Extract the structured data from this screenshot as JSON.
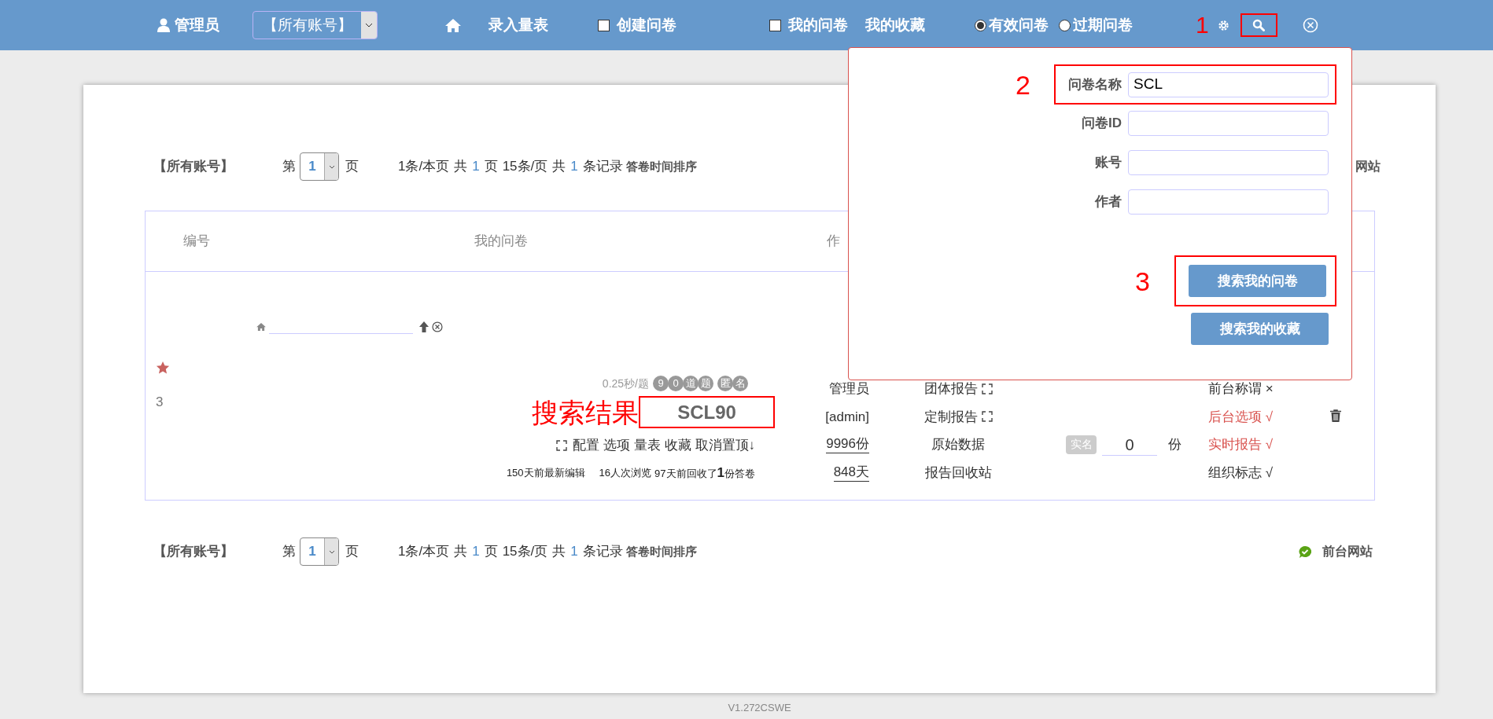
{
  "top_bar": {
    "user": "管理员",
    "account_select": "【所有账号】",
    "entry_link": "录入量表",
    "create": {
      "label": "创建问卷",
      "checked": false
    },
    "mine": {
      "label": "我的问卷",
      "checked": false
    },
    "favorites_link": "我的收藏",
    "status": [
      {
        "label": "有效问卷",
        "selected": true
      },
      {
        "label": "过期问卷",
        "selected": false
      }
    ],
    "search_marker": "1"
  },
  "search_panel": {
    "fields": [
      {
        "label": "问卷名称",
        "value": "SCL",
        "marker": "2"
      },
      {
        "label": "问卷ID"
      },
      {
        "label": "账号"
      },
      {
        "label": "作者"
      }
    ],
    "buttons": [
      {
        "label": "搜索我的问卷",
        "marker": "3"
      },
      {
        "label": "搜索我的收藏"
      }
    ]
  },
  "pagers": [
    {
      "account": "【所有账号】",
      "page_label": "第",
      "page": "1",
      "page_unit": "页",
      "summary": [
        {
          "kind": "text",
          "text": "1条/本页"
        },
        {
          "kind": "text",
          "text": "共"
        },
        {
          "kind": "count",
          "text": "1"
        },
        {
          "kind": "text",
          "text": "页"
        },
        {
          "kind": "text",
          "text": "15条/页"
        },
        {
          "kind": "text",
          "text": "共"
        },
        {
          "kind": "count",
          "text": "1"
        },
        {
          "kind": "text",
          "text": "条记录"
        }
      ],
      "sort_link": "答卷时间排序",
      "site_link": {
        "text": "网站",
        "icon": false
      }
    },
    {
      "account": "【所有账号】",
      "page_label": "第",
      "page": "1",
      "page_unit": "页",
      "summary": [
        {
          "kind": "text",
          "text": "1条/本页"
        },
        {
          "kind": "text",
          "text": "共"
        },
        {
          "kind": "count",
          "text": "1"
        },
        {
          "kind": "text",
          "text": "页"
        },
        {
          "kind": "text",
          "text": "15条/页"
        },
        {
          "kind": "text",
          "text": "共"
        },
        {
          "kind": "count",
          "text": "1"
        },
        {
          "kind": "text",
          "text": "条记录"
        }
      ],
      "sort_link": "答卷时间排序",
      "site_link": {
        "text": "前台网站",
        "icon": true
      }
    }
  ],
  "table": {
    "columns": [
      "编号",
      "我的问卷",
      "作"
    ],
    "rows": [
      {
        "starred": true,
        "number": "3",
        "pace": "0.25秒/题",
        "question_badges": [
          "9",
          "0",
          "道",
          "题"
        ],
        "mode_badges": [
          "匿",
          "名"
        ],
        "title": "SCL90",
        "title_marker": "搜索结果",
        "actions": [
          "配置",
          "选项",
          "量表",
          "收藏",
          "取消置顶↓"
        ],
        "stats": [
          "150天前最新编辑",
          "16人次浏览",
          "97天前回收了**1**份答卷"
        ],
        "author_lines": [
          {
            "text": "管理员",
            "underlined": false
          },
          {
            "text": "[admin]",
            "underlined": false
          },
          {
            "text": "9996份",
            "underlined": true
          },
          {
            "text": "848天",
            "underlined": true
          }
        ],
        "reports": [
          {
            "label": "团体报告",
            "scan_icon": true
          },
          {
            "label": "定制报告",
            "scan_icon": true
          },
          {
            "label": "原始数据",
            "scan_icon": false
          },
          {
            "label": "报告回收站",
            "scan_icon": false
          }
        ],
        "realname_badge": "实名",
        "response_count": "0",
        "count_unit": "份",
        "flags": [
          {
            "label": "前台称谓 ×",
            "color": "#333333"
          },
          {
            "label": "后台选项 √",
            "color": "#d9534f"
          },
          {
            "label": "实时报告 √",
            "color": "#d9534f"
          },
          {
            "label": "组织标志 √",
            "color": "#333333"
          }
        ]
      }
    ]
  },
  "version": "V1.272CSWE"
}
